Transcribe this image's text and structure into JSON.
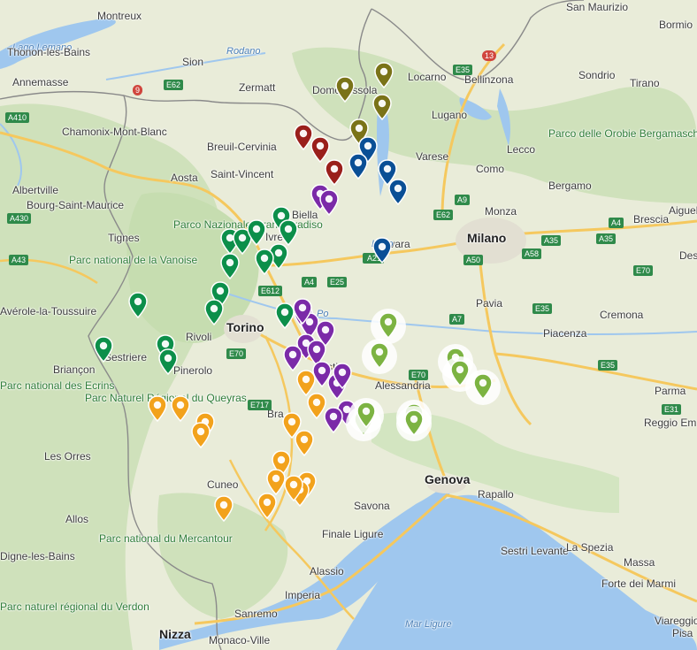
{
  "map": {
    "colors": {
      "land": "#e9ecd9",
      "sea": "#9fc7ee",
      "lake": "#9fc7ee",
      "forest": "#c9dfb4",
      "border": "#8a8a8a",
      "highway": "#f5c85e"
    },
    "labels": [
      {
        "text": "Montreux"
      },
      {
        "text": "Lago Lemano"
      },
      {
        "text": "Thonon-les-Bains"
      },
      {
        "text": "Annemasse"
      },
      {
        "text": "Sion"
      },
      {
        "text": "Rodano"
      },
      {
        "text": "Zermatt"
      },
      {
        "text": "Chamonix-Mont-Blanc"
      },
      {
        "text": "Breuil-Cervinia"
      },
      {
        "text": "Aosta"
      },
      {
        "text": "Saint-Vincent"
      },
      {
        "text": "Albertville"
      },
      {
        "text": "Bourg-Saint-Maurice"
      },
      {
        "text": "Tignes"
      },
      {
        "text": "Domodossola"
      },
      {
        "text": "Locarno"
      },
      {
        "text": "Bellinzona"
      },
      {
        "text": "Lugano"
      },
      {
        "text": "Varese"
      },
      {
        "text": "Como"
      },
      {
        "text": "Lecco"
      },
      {
        "text": "Bergamo"
      },
      {
        "text": "Sondrio"
      },
      {
        "text": "Tirano"
      },
      {
        "text": "Bormio"
      },
      {
        "text": "San Maurizio"
      },
      {
        "text": "Monza"
      },
      {
        "text": "Brescia"
      },
      {
        "text": "Milano"
      },
      {
        "text": "Novara"
      },
      {
        "text": "Biella"
      },
      {
        "text": "Ivrea"
      },
      {
        "text": "Torino"
      },
      {
        "text": "Rivoli"
      },
      {
        "text": "Pinerolo"
      },
      {
        "text": "Sestriere"
      },
      {
        "text": "Briançon"
      },
      {
        "text": "Asti"
      },
      {
        "text": "Alessandria"
      },
      {
        "text": "Pavia"
      },
      {
        "text": "Piacenza"
      },
      {
        "text": "Cremona"
      },
      {
        "text": "Parma"
      },
      {
        "text": "Reggio Em"
      },
      {
        "text": "Bra"
      },
      {
        "text": "Cuneo"
      },
      {
        "text": "Genova"
      },
      {
        "text": "Rapallo"
      },
      {
        "text": "Sestri Levante"
      },
      {
        "text": "Savona"
      },
      {
        "text": "Finale Ligure"
      },
      {
        "text": "Alassio"
      },
      {
        "text": "Imperia"
      },
      {
        "text": "Sanremo"
      },
      {
        "text": "Nizza"
      },
      {
        "text": "Monaco-Ville"
      },
      {
        "text": "La Spezia"
      },
      {
        "text": "Massa"
      },
      {
        "text": "Forte dei Marmi"
      },
      {
        "text": "Viareggio"
      },
      {
        "text": "Pisa"
      },
      {
        "text": "Les Orres"
      },
      {
        "text": "Allos"
      },
      {
        "text": "Mar Ligure"
      },
      {
        "text": "Desenzano"
      },
      {
        "text": "Aiguebelle"
      },
      {
        "text": "Avérole-la-Toussuire"
      },
      {
        "text": "Digne-les-Bains"
      },
      {
        "text": "Parco Nazionale Gran Paradiso"
      },
      {
        "text": "Parc national de la Vanoise"
      },
      {
        "text": "Parc national des Ecrins"
      },
      {
        "text": "Parc Naturel Régional du Queyras"
      },
      {
        "text": "Parc national du Mercantour"
      },
      {
        "text": "Parc naturel régional du Verdon"
      },
      {
        "text": "Parco delle Orobie Bergamasche"
      },
      {
        "text": "Po"
      },
      {
        "text": "Lago"
      }
    ],
    "road_shields": [
      "E35",
      "13",
      "9",
      "E62",
      "A410",
      "A430",
      "A43",
      "E612",
      "A4",
      "E25",
      "A26",
      "A9",
      "E62",
      "A4",
      "A35",
      "A50",
      "A58",
      "E70",
      "A7",
      "E35",
      "A35",
      "E70",
      "E717",
      "E31",
      "E70",
      "E35",
      "A21"
    ],
    "pins": [
      {
        "color": "#7a7318"
      },
      {
        "color": "#7a7318"
      },
      {
        "color": "#7a7318"
      },
      {
        "color": "#7a7318"
      },
      {
        "color": "#9a1f1b"
      },
      {
        "color": "#9a1f1b"
      },
      {
        "color": "#9a1f1b"
      },
      {
        "color": "#0a4f96"
      },
      {
        "color": "#0a4f96"
      },
      {
        "color": "#0a4f96"
      },
      {
        "color": "#0a4f96"
      },
      {
        "color": "#0a4f96"
      },
      {
        "color": "#7b2aa8"
      },
      {
        "color": "#7b2aa8"
      },
      {
        "color": "#7b2aa8"
      },
      {
        "color": "#7b2aa8"
      },
      {
        "color": "#7b2aa8"
      },
      {
        "color": "#7b2aa8"
      },
      {
        "color": "#7b2aa8"
      },
      {
        "color": "#7b2aa8"
      },
      {
        "color": "#7b2aa8"
      },
      {
        "color": "#7b2aa8"
      },
      {
        "color": "#7b2aa8"
      },
      {
        "color": "#7b2aa8"
      },
      {
        "color": "#7b2aa8"
      },
      {
        "color": "#7b2aa8"
      },
      {
        "color": "#0c8f4a"
      },
      {
        "color": "#0c8f4a"
      },
      {
        "color": "#0c8f4a"
      },
      {
        "color": "#0c8f4a"
      },
      {
        "color": "#0c8f4a"
      },
      {
        "color": "#0c8f4a"
      },
      {
        "color": "#0c8f4a"
      },
      {
        "color": "#0c8f4a"
      },
      {
        "color": "#0c8f4a"
      },
      {
        "color": "#0c8f4a"
      },
      {
        "color": "#0c8f4a"
      },
      {
        "color": "#0c8f4a"
      },
      {
        "color": "#0c8f4a"
      },
      {
        "color": "#0c8f4a"
      },
      {
        "color": "#0c8f4a"
      },
      {
        "color": "#f2a21c"
      },
      {
        "color": "#f2a21c"
      },
      {
        "color": "#f2a21c"
      },
      {
        "color": "#f2a21c"
      },
      {
        "color": "#f2a21c"
      },
      {
        "color": "#f2a21c"
      },
      {
        "color": "#f2a21c"
      },
      {
        "color": "#f2a21c"
      },
      {
        "color": "#f2a21c"
      },
      {
        "color": "#f2a21c"
      },
      {
        "color": "#f2a21c"
      },
      {
        "color": "#f2a21c"
      },
      {
        "color": "#f2a21c"
      },
      {
        "color": "#f2a21c"
      },
      {
        "color": "#f2a21c"
      },
      {
        "color": "#7cb342",
        "halo": true
      },
      {
        "color": "#7cb342",
        "halo": true
      },
      {
        "color": "#7cb342",
        "halo": true
      },
      {
        "color": "#7cb342",
        "halo": true
      },
      {
        "color": "#7cb342",
        "halo": true
      },
      {
        "color": "#7cb342",
        "halo": true
      },
      {
        "color": "#7cb342",
        "halo": true
      },
      {
        "color": "#7cb342",
        "halo": true
      },
      {
        "color": "#7cb342",
        "halo": true
      }
    ]
  }
}
